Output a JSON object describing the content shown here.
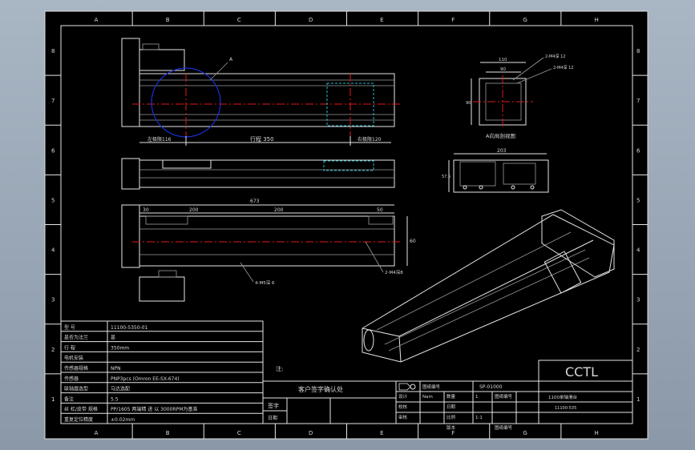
{
  "border_letters": [
    "A",
    "B",
    "C",
    "D",
    "E",
    "F",
    "G",
    "H"
  ],
  "border_numbers": [
    "8",
    "7",
    "6",
    "5",
    "4",
    "3",
    "2",
    "1"
  ],
  "dims": {
    "detail_a": "A",
    "left_limit": "左极限116",
    "stroke": "行程 350",
    "right_limit": "右极限120",
    "total": "673",
    "pitch_30": "30",
    "pitch_a": "200",
    "pitch_b": "200",
    "pitch_50": "50",
    "height_60": "60",
    "hole_left": "4-M5深 6",
    "hole_right": "2-M4深8",
    "flange_w": "110",
    "flange_inner": "90",
    "flange_h": "90",
    "flange_hole_a": "2-M4深 12",
    "flange_hole_b": "2-M4深 12",
    "flange_caption": "A向局剖视图",
    "side_w": "203",
    "side_h": "57.5"
  },
  "spec_table": {
    "rows": [
      {
        "label": "型  号",
        "value": "11100-5350-01"
      },
      {
        "label": "是否为法兰",
        "value": "是"
      },
      {
        "label": "行  程",
        "value": "350mm"
      },
      {
        "label": "电机安装",
        "value": ""
      },
      {
        "label": "传感器规格",
        "value": "NPN"
      },
      {
        "label": "传感器",
        "value": "PNP3pcs (Omron EE-SX-674)"
      },
      {
        "label": "联轴器选型",
        "value": "马达选配"
      },
      {
        "label": "备注",
        "value": "5.5"
      },
      {
        "label": "丝 杠/皮带 规格",
        "value": "PP/1605 两端精 进 以 3000RPM为基准"
      },
      {
        "label": "重复定位精度",
        "value": "±0.02mm"
      }
    ]
  },
  "notes_label": "注:",
  "approval": {
    "title": "客户签字确认处",
    "sign_label": "签字",
    "date_label": "日期"
  },
  "title_block": {
    "brand": "CCTL",
    "drawing_no_label": "图纸编号",
    "drawing_no": "SP-01000",
    "product_name": "1100单轴滑台",
    "part_no": "11100-535",
    "row1": [
      "设计",
      "Nam",
      "数量",
      "1",
      "图纸编号",
      ""
    ],
    "row2": [
      "校核",
      "",
      "日期",
      "",
      "",
      ""
    ],
    "row3": [
      "审核",
      "",
      "比例",
      "1:1",
      "",
      ""
    ],
    "row4": [
      "",
      "",
      "版本",
      "",
      "图纸编号",
      ""
    ]
  }
}
